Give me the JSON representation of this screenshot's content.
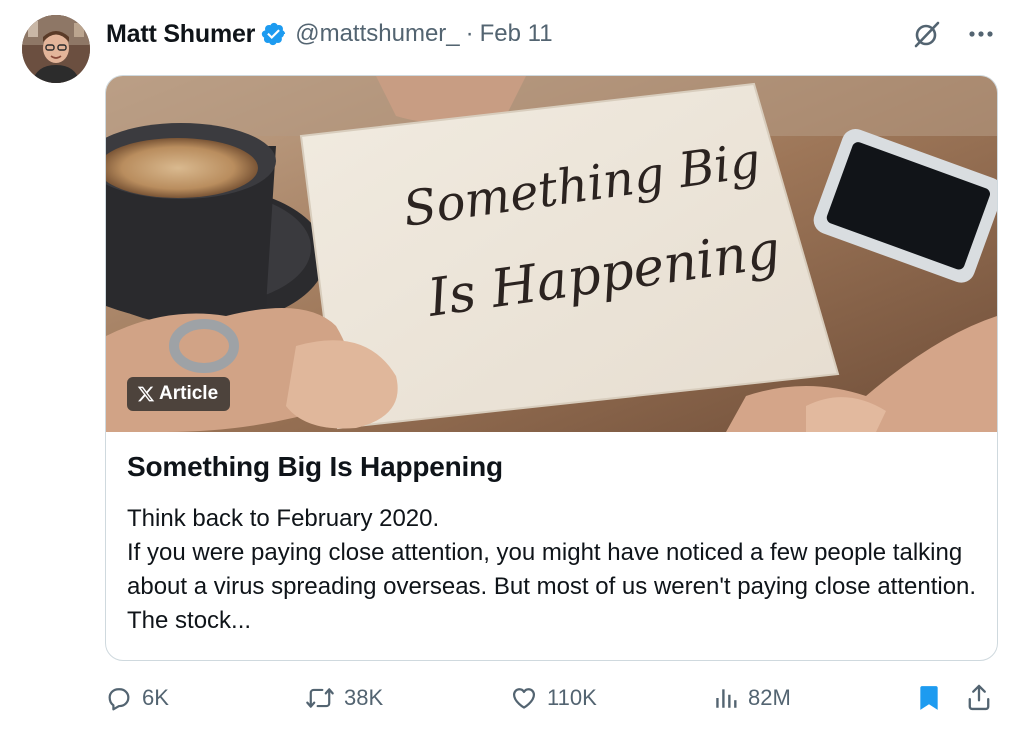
{
  "author": {
    "name": "Matt Shumer",
    "handle": "@mattshumer_",
    "separator": "·",
    "date": "Feb 11"
  },
  "header_icons": [
    "grok-icon",
    "more-icon"
  ],
  "article": {
    "badge": "Article",
    "image_text": [
      "Something Big",
      "Is Happening"
    ],
    "title": "Something Big Is Happening",
    "lines": [
      "Think back to February 2020.",
      "If you were paying close attention, you might have noticed a few people talking about a virus spreading overseas. But most of us weren't paying close attention. The stock..."
    ]
  },
  "actions": {
    "replies": "6K",
    "reposts": "38K",
    "likes": "110K",
    "views": "82M"
  },
  "colors": {
    "text": "#0f1419",
    "muted": "#536471",
    "accent": "#1d9bf0",
    "border": "#cfd9de"
  }
}
